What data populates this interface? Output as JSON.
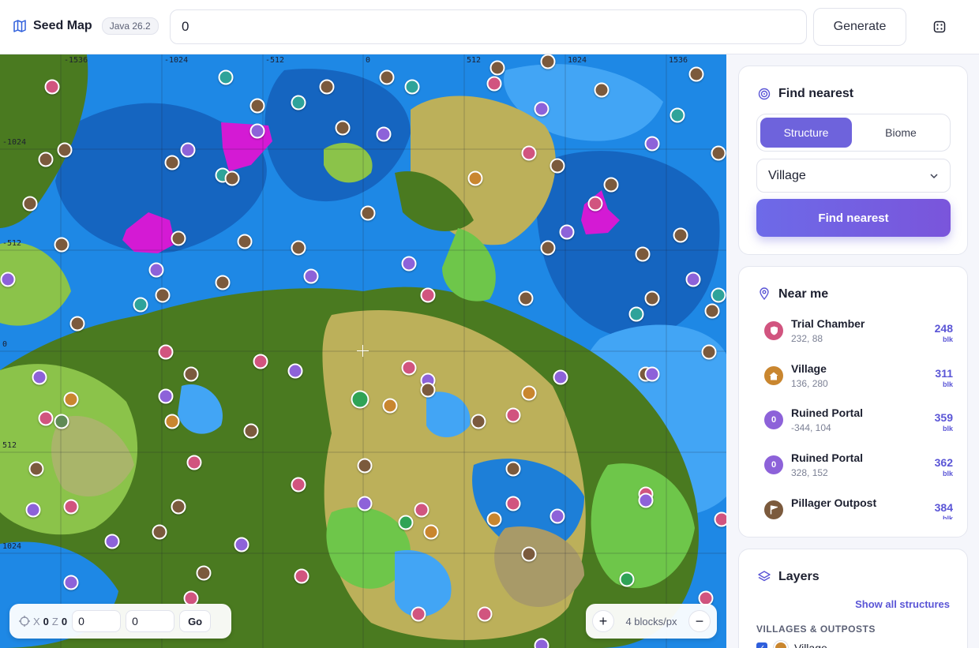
{
  "app": {
    "title": "Seed Map",
    "version": "Java 26.2"
  },
  "seed": {
    "value": "0"
  },
  "actions": {
    "generate_label": "Generate"
  },
  "map": {
    "grid_labels_x": [
      "-1536",
      "-1024",
      "-512",
      "0",
      "512",
      "1024",
      "1536"
    ],
    "grid_labels_y": [
      "-1024",
      "-512",
      "0",
      "512",
      "1024"
    ],
    "colors": {
      "deep_ocean": "#1565c0",
      "ocean": "#1e88e5",
      "shallow": "#42a5f5",
      "plains": "#8bc34a",
      "forest": "#4a7a20",
      "savanna": "#bcb05a",
      "mushroom": "#d41ad4"
    }
  },
  "coordinates": {
    "x_label": "X",
    "x_value": "0",
    "z_label": "Z",
    "z_value": "0",
    "x_input": "0",
    "z_input": "0",
    "go_label": "Go"
  },
  "zoom": {
    "label": "4 blocks/px",
    "plus": "+",
    "minus": "−"
  },
  "find_nearest": {
    "title": "Find nearest",
    "tabs": [
      {
        "label": "Structure",
        "active": true
      },
      {
        "label": "Biome",
        "active": false
      }
    ],
    "selected": "Village",
    "button_label": "Find nearest"
  },
  "near_me": {
    "title": "Near me",
    "items": [
      {
        "name": "Trial Chamber",
        "coords": "232, 88",
        "distance": "248",
        "unit": "blk",
        "color": "#d1547f",
        "icon": "shield-icon"
      },
      {
        "name": "Village",
        "coords": "136, 280",
        "distance": "311",
        "unit": "blk",
        "color": "#c9862f",
        "icon": "house-icon"
      },
      {
        "name": "Ruined Portal",
        "coords": "-344, 104",
        "distance": "359",
        "unit": "blk",
        "color": "#8d62d9",
        "icon": "portal-icon",
        "glyph": "0"
      },
      {
        "name": "Ruined Portal",
        "coords": "328, 152",
        "distance": "362",
        "unit": "blk",
        "color": "#8d62d9",
        "icon": "portal-icon",
        "glyph": "0"
      },
      {
        "name": "Pillager Outpost",
        "coords": "",
        "distance": "384",
        "unit": "blk",
        "color": "#7b5a3d",
        "icon": "flag-icon"
      }
    ]
  },
  "layers": {
    "title": "Layers",
    "show_all_label": "Show all structures",
    "section_label": "VILLAGES & OUTPOSTS",
    "first_layer": "Village"
  }
}
